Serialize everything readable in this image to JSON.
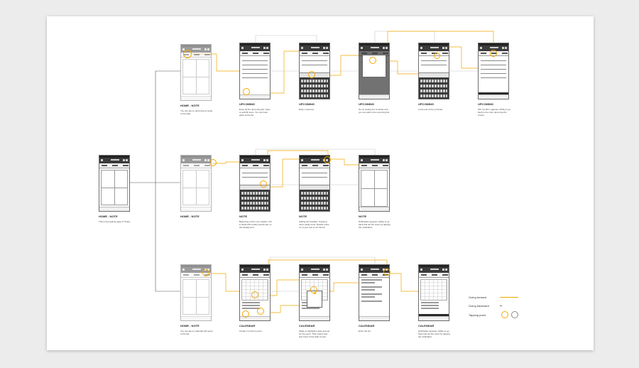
{
  "screens": [
    {
      "key": "home-note-main",
      "title": "HOME - NOTE",
      "desc": "This is the landing page of Tickky",
      "kind": "home",
      "faded": false
    },
    {
      "key": "home-note-upcoming",
      "title": "HOME - NOTE",
      "desc": "You can tap on upcoming to setup to the right.",
      "kind": "grid",
      "faded": true
    },
    {
      "key": "upcoming-1",
      "title": "UPCOMING",
      "desc": "Enter all the upcoming tab. Open or add fill notes. You can have place at the list.",
      "kind": "form",
      "faded": false
    },
    {
      "key": "upcoming-2",
      "title": "UPCOMING",
      "desc": "Enter it and text.",
      "kind": "keyboard",
      "faded": false
    },
    {
      "key": "upcoming-3",
      "title": "UPCOMING",
      "desc": "Go on setting the reminder and you can add to the upcoming list.",
      "kind": "overlay",
      "faded": false
    },
    {
      "key": "upcoming-4",
      "title": "UPCOMING",
      "desc": "In the end of the reminder.",
      "kind": "keyboard",
      "faded": false
    },
    {
      "key": "upcoming-5",
      "title": "UPCOMING",
      "desc": "Tab 'Confirm' appears. Ability to go back to the main upcoming list screen.",
      "kind": "confirm",
      "faded": false
    },
    {
      "key": "home-note-note",
      "title": "HOME - NOTE",
      "desc": "",
      "kind": "grid",
      "faded": true
    },
    {
      "key": "note-1",
      "title": "NOTE",
      "desc": "Beginning of the note creation. Fill in fields with a daily specify bar on the background.",
      "kind": "keyboard",
      "faded": false
    },
    {
      "key": "note-2",
      "title": "NOTE",
      "desc": "Adding list checklist. Pressing return adds a line. Double press on of your text to set the list.",
      "kind": "keyboard",
      "faded": false
    },
    {
      "key": "note-3",
      "title": "NOTE",
      "desc": "Notification appears. Ability to go back and set the event by tapping the notification.",
      "kind": "notegrid",
      "faded": false
    },
    {
      "key": "home-note-calendar",
      "title": "HOME - NOTE",
      "desc": "You can tap on calendar tab setup to the left.",
      "kind": "grid",
      "faded": true
    },
    {
      "key": "calendar-1",
      "title": "CALENDAR",
      "desc": "Create it to tell an event.",
      "kind": "calendar",
      "faded": false
    },
    {
      "key": "calendar-2",
      "title": "CALENDAR",
      "desc": "Ability to highlight a date and set for the event. Then select type and event of the date to pick.",
      "kind": "calendar-pick",
      "faded": false
    },
    {
      "key": "calendar-3",
      "title": "CALENDAR",
      "desc": "Enter the list.",
      "kind": "list",
      "faded": false
    },
    {
      "key": "calendar-4",
      "title": "CALENDAR",
      "desc": "Notification appears. Ability to go back and set the event by tapping the notification.",
      "kind": "calendar-confirm",
      "faded": false
    }
  ],
  "legend": {
    "forward": "Going forward",
    "backward": "Going backward",
    "tapping": "Tapping point"
  },
  "colors": {
    "forward": "#f2a900",
    "backward": "#c8c8c8",
    "connector": "#555555",
    "tap": "#f2a900"
  }
}
